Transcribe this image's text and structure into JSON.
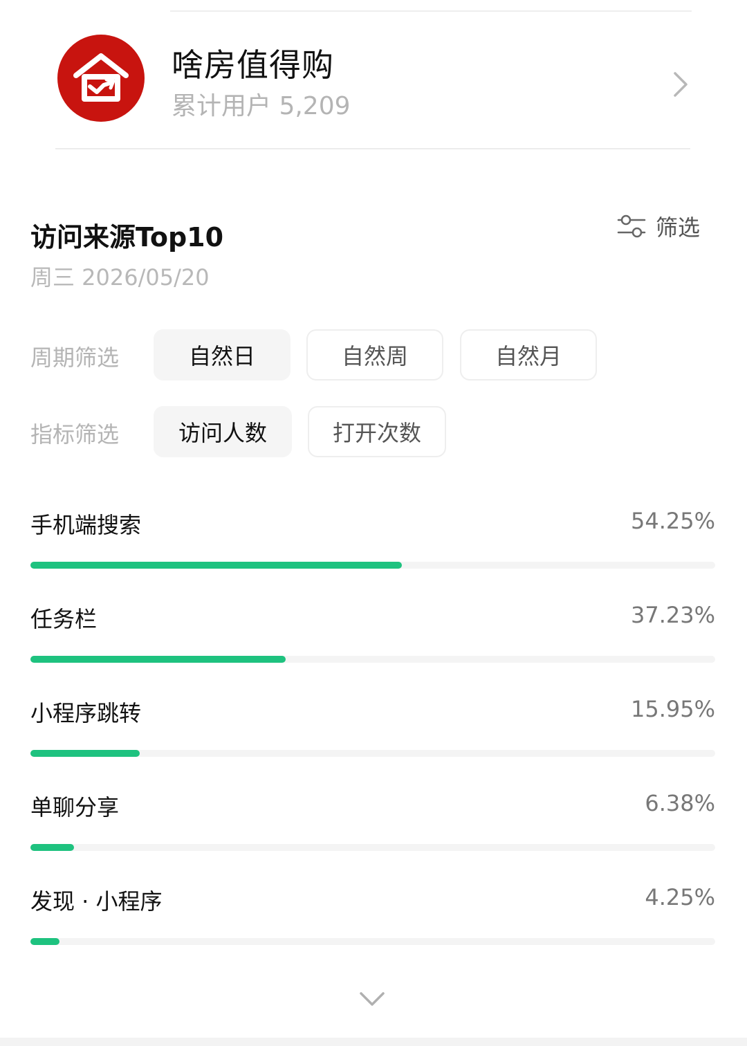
{
  "app": {
    "name": "啥房值得购",
    "users_label": "累计用户 5,209",
    "brand_color": "#c8140f",
    "logo_icon": "house-chart-icon"
  },
  "section": {
    "title": "访问来源Top10",
    "date": "周三 2026/05/20",
    "filter_label": "筛选",
    "filter_icon": "sliders-icon"
  },
  "period_filter": {
    "label": "周期筛选",
    "options": [
      {
        "label": "自然日",
        "selected": true
      },
      {
        "label": "自然周",
        "selected": false
      },
      {
        "label": "自然月",
        "selected": false
      }
    ]
  },
  "metric_filter": {
    "label": "指标筛选",
    "options": [
      {
        "label": "访问人数",
        "selected": true
      },
      {
        "label": "打开次数",
        "selected": false
      }
    ]
  },
  "accent_color": "#1ec27f",
  "sources": [
    {
      "name": "手机端搜索",
      "percent_label": "54.25%",
      "percent": 54.25
    },
    {
      "name": "任务栏",
      "percent_label": "37.23%",
      "percent": 37.23
    },
    {
      "name": "小程序跳转",
      "percent_label": "15.95%",
      "percent": 15.95
    },
    {
      "name": "单聊分享",
      "percent_label": "6.38%",
      "percent": 6.38
    },
    {
      "name": "发现 · 小程序",
      "percent_label": "4.25%",
      "percent": 4.25
    }
  ],
  "expand_icon": "chevron-down-icon"
}
